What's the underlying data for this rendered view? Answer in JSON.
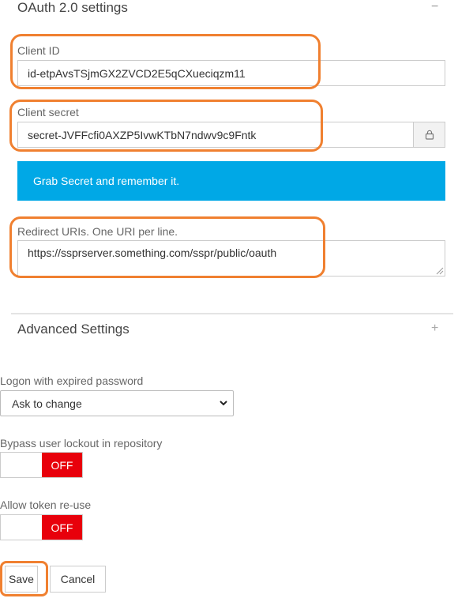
{
  "oauth": {
    "title": "OAuth 2.0 settings",
    "collapse_symbol": "−",
    "client_id_label": "Client ID",
    "client_id_value": "id-etpAvsTSjmGX2ZVCD2E5qCXueciqzm11",
    "client_secret_label": "Client secret",
    "client_secret_value": "secret-JVFFcfi0AXZP5IvwKTbN7ndwv9c9Fntk",
    "secret_callout": "Grab Secret and remember it.",
    "redirect_label": "Redirect URIs. One URI per line.",
    "redirect_value": "https://ssprserver.something.com/sspr/public/oauth"
  },
  "advanced": {
    "title": "Advanced Settings",
    "expand_symbol": "+"
  },
  "logon_expired": {
    "label": "Logon with expired password",
    "selected": "Ask to change"
  },
  "bypass_lockout": {
    "label": "Bypass user lockout in repository",
    "state": "OFF"
  },
  "token_reuse": {
    "label": "Allow token re-use",
    "state": "OFF"
  },
  "actions": {
    "save": "Save",
    "cancel": "Cancel"
  },
  "colors": {
    "callout": "#00a8e6",
    "toggle_off": "#e8000b",
    "highlight": "#f08030"
  },
  "icons": {
    "lock": "lock-icon",
    "caret": "chevron-down-icon"
  }
}
